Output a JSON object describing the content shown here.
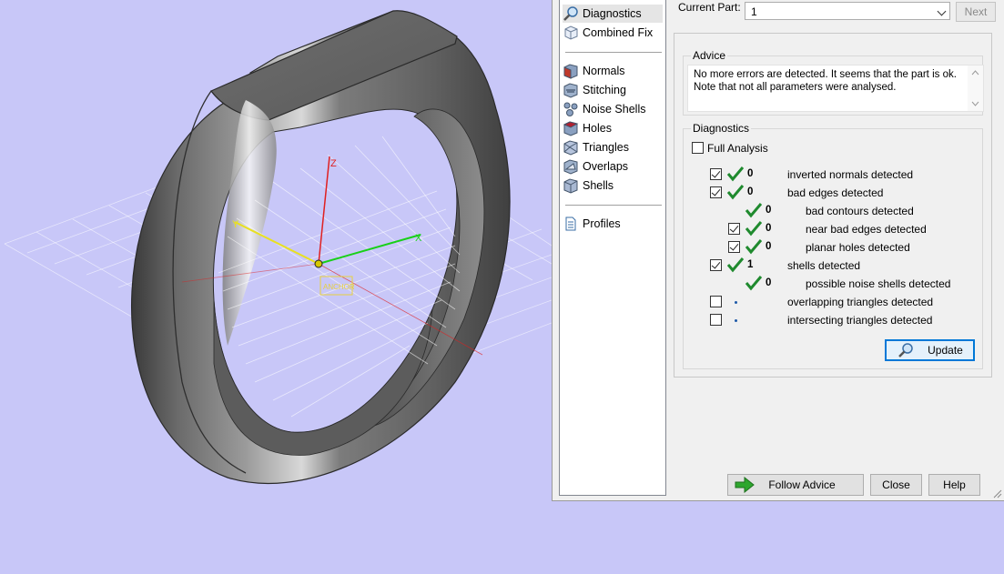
{
  "viewport": {
    "axis_labels": {
      "z": "Z",
      "y": "Y",
      "x": "X"
    },
    "axis_colors": {
      "x": "#18d018",
      "y": "#e8e020",
      "z": "#e02020"
    },
    "origin_marker": "ANCHOR"
  },
  "sidebar": {
    "items": [
      {
        "label": "Diagnostics",
        "icon": "magnifier-icon"
      },
      {
        "label": "Combined Fix",
        "icon": "cube-icon"
      },
      {
        "label": "Normals",
        "icon": "normals-cube-icon"
      },
      {
        "label": "Stitching",
        "icon": "stitching-cube-icon"
      },
      {
        "label": "Noise Shells",
        "icon": "noise-shells-icon"
      },
      {
        "label": "Holes",
        "icon": "holes-cube-icon"
      },
      {
        "label": "Triangles",
        "icon": "triangles-icon"
      },
      {
        "label": "Overlaps",
        "icon": "overlaps-icon"
      },
      {
        "label": "Shells",
        "icon": "shells-icon"
      },
      {
        "label": "Profiles",
        "icon": "document-icon"
      }
    ]
  },
  "header": {
    "current_part_label": "Current Part:",
    "current_part_value": "1",
    "next_label": "Next"
  },
  "advice": {
    "title": "Advice",
    "line1": "No more errors are detected. It seems that the part is ok.",
    "line2": "Note that not all parameters were analysed."
  },
  "diagnostics": {
    "title": "Diagnostics",
    "full_analysis_label": "Full Analysis",
    "full_analysis_checked": false,
    "rows": [
      {
        "checked": true,
        "status": "ok",
        "count": "0",
        "label": "inverted normals detected",
        "indent": 0
      },
      {
        "checked": true,
        "status": "ok",
        "count": "0",
        "label": "bad edges detected",
        "indent": 0
      },
      {
        "checked": null,
        "status": "ok",
        "count": "0",
        "label": "bad contours detected",
        "indent": 1
      },
      {
        "checked": true,
        "status": "ok",
        "count": "0",
        "label": "near bad edges detected",
        "indent": 1
      },
      {
        "checked": true,
        "status": "ok",
        "count": "0",
        "label": "planar holes detected",
        "indent": 1
      },
      {
        "checked": true,
        "status": "ok",
        "count": "1",
        "label": "shells detected",
        "indent": 0
      },
      {
        "checked": null,
        "status": "ok",
        "count": "0",
        "label": "possible noise shells detected",
        "indent": 1
      },
      {
        "checked": false,
        "status": "pending",
        "count": "",
        "label": "overlapping triangles detected",
        "indent": 0
      },
      {
        "checked": false,
        "status": "pending",
        "count": "",
        "label": "intersecting triangles detected",
        "indent": 0
      }
    ],
    "update_label": "Update"
  },
  "footer": {
    "follow_advice_label": "Follow Advice",
    "close_label": "Close",
    "help_label": "Help"
  },
  "colors": {
    "viewport_bg": "#c8c7f8",
    "tick_green": "#1f8a2e",
    "arrow_green": "#2ea62e",
    "accent_blue": "#0078d7"
  }
}
